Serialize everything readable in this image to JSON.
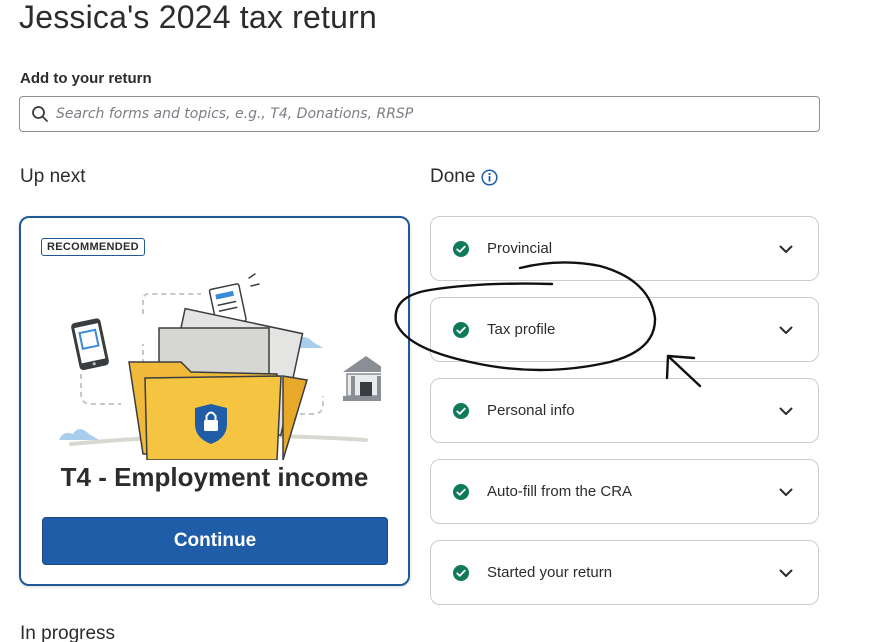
{
  "header": {
    "title": "Jessica's 2024 tax return"
  },
  "search": {
    "label": "Add to your return",
    "placeholder": "Search forms and topics, e.g., T4, Donations, RRSP",
    "icon": "search-icon"
  },
  "up_next": {
    "heading": "Up next",
    "card": {
      "badge": "RECOMMENDED",
      "title": "T4 - Employment income",
      "button_label": "Continue"
    }
  },
  "done": {
    "heading": "Done",
    "info_icon": "info-icon",
    "items": [
      {
        "label": "Provincial"
      },
      {
        "label": "Tax profile"
      },
      {
        "label": "Personal info"
      },
      {
        "label": "Auto-fill from the CRA"
      },
      {
        "label": "Started your return"
      }
    ]
  },
  "in_progress": {
    "heading": "In progress"
  },
  "colors": {
    "primary_blue": "#1f5da8",
    "check_green": "#0f7a5a",
    "folder_yellow": "#f5c542",
    "card_border": "#1f5a96"
  }
}
